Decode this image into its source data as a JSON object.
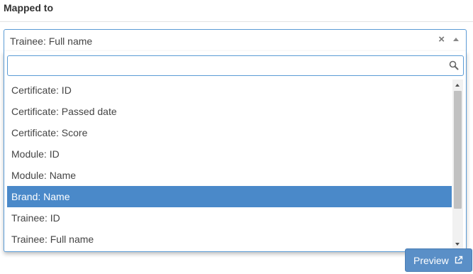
{
  "field": {
    "label": "Mapped to"
  },
  "select": {
    "selected_value": "Trainee: Full name",
    "clear_symbol": "×"
  },
  "search": {
    "value": "",
    "placeholder": ""
  },
  "options": [
    {
      "label": "Certificate: ID",
      "highlighted": false
    },
    {
      "label": "Certificate: Passed date",
      "highlighted": false
    },
    {
      "label": "Certificate: Score",
      "highlighted": false
    },
    {
      "label": "Module: ID",
      "highlighted": false
    },
    {
      "label": "Module: Name",
      "highlighted": false
    },
    {
      "label": "Brand: Name",
      "highlighted": true
    },
    {
      "label": "Trainee: ID",
      "highlighted": false
    },
    {
      "label": "Trainee: Full name",
      "highlighted": false
    }
  ],
  "preview_button": {
    "label": "Preview"
  },
  "colors": {
    "accent": "#5b9bd5",
    "highlight": "#4a89c9",
    "button": "#5a8fc7"
  },
  "icons": {
    "clear": "close-icon",
    "caret": "caret-up-icon",
    "search": "search-icon",
    "external_link": "external-link-icon"
  }
}
